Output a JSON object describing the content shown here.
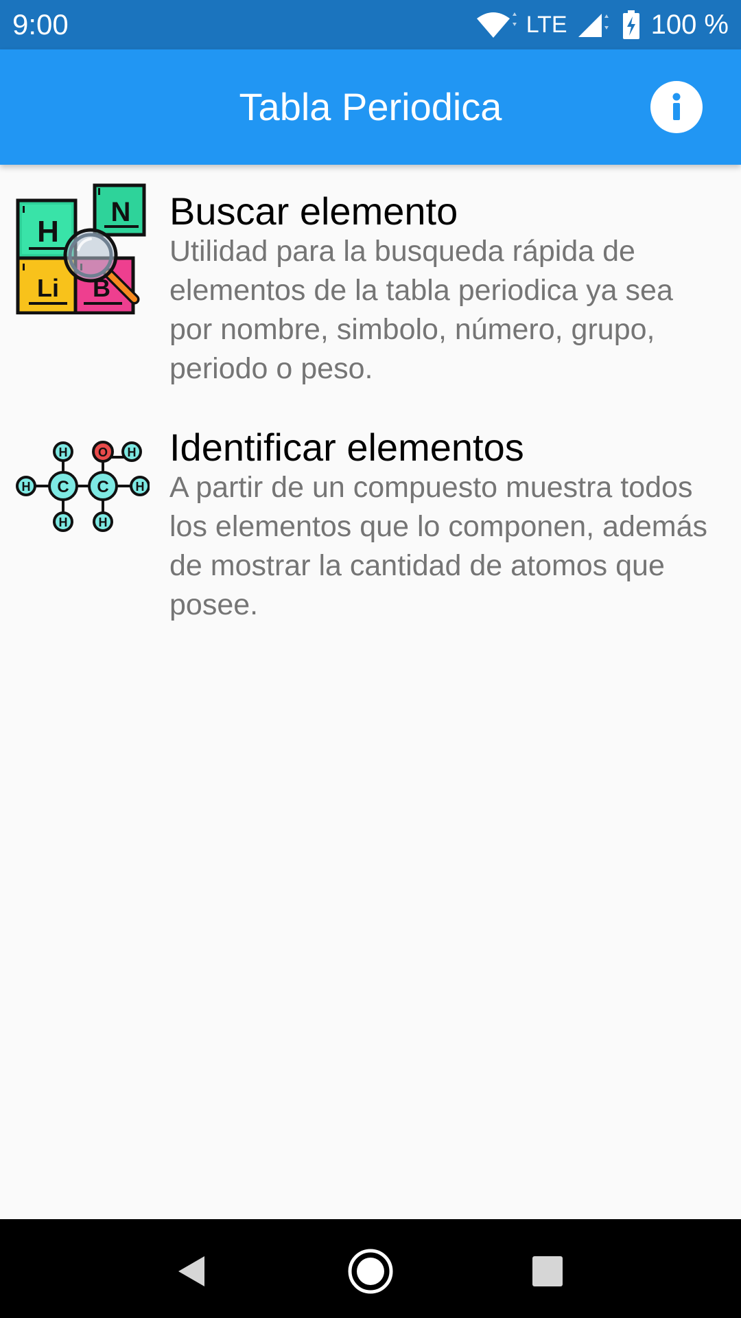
{
  "status_bar": {
    "time": "9:00",
    "network": "LTE",
    "battery": "100 %",
    "wifi_icon": "wifi-icon",
    "signal_icon": "cell-signal-icon",
    "battery_icon": "battery-charging-icon"
  },
  "app_bar": {
    "title": "Tabla Periodica",
    "info_icon": "info-icon",
    "color": "#2196f3",
    "status_color": "#1b74be"
  },
  "items": [
    {
      "title": "Buscar elemento",
      "description": "Utilidad para la busqueda rápida de elementos de la tabla periodica ya sea por nombre, simbolo, número, grupo, periodo o peso.",
      "icon": "periodic-table-search-icon",
      "icon_text": {
        "h": "H",
        "n": "N",
        "li": "Li",
        "b": "B"
      }
    },
    {
      "title": "Identificar elementos",
      "description": "A partir de un compuesto muestra todos los elementos que lo componen, además de mostrar la cantidad de atomos que posee.",
      "icon": "molecule-icon",
      "icon_text": {
        "h": "H",
        "c": "C",
        "o": "O"
      }
    }
  ],
  "nav_bar": {
    "back_icon": "back-icon",
    "home_icon": "home-icon",
    "recents_icon": "recents-icon"
  }
}
